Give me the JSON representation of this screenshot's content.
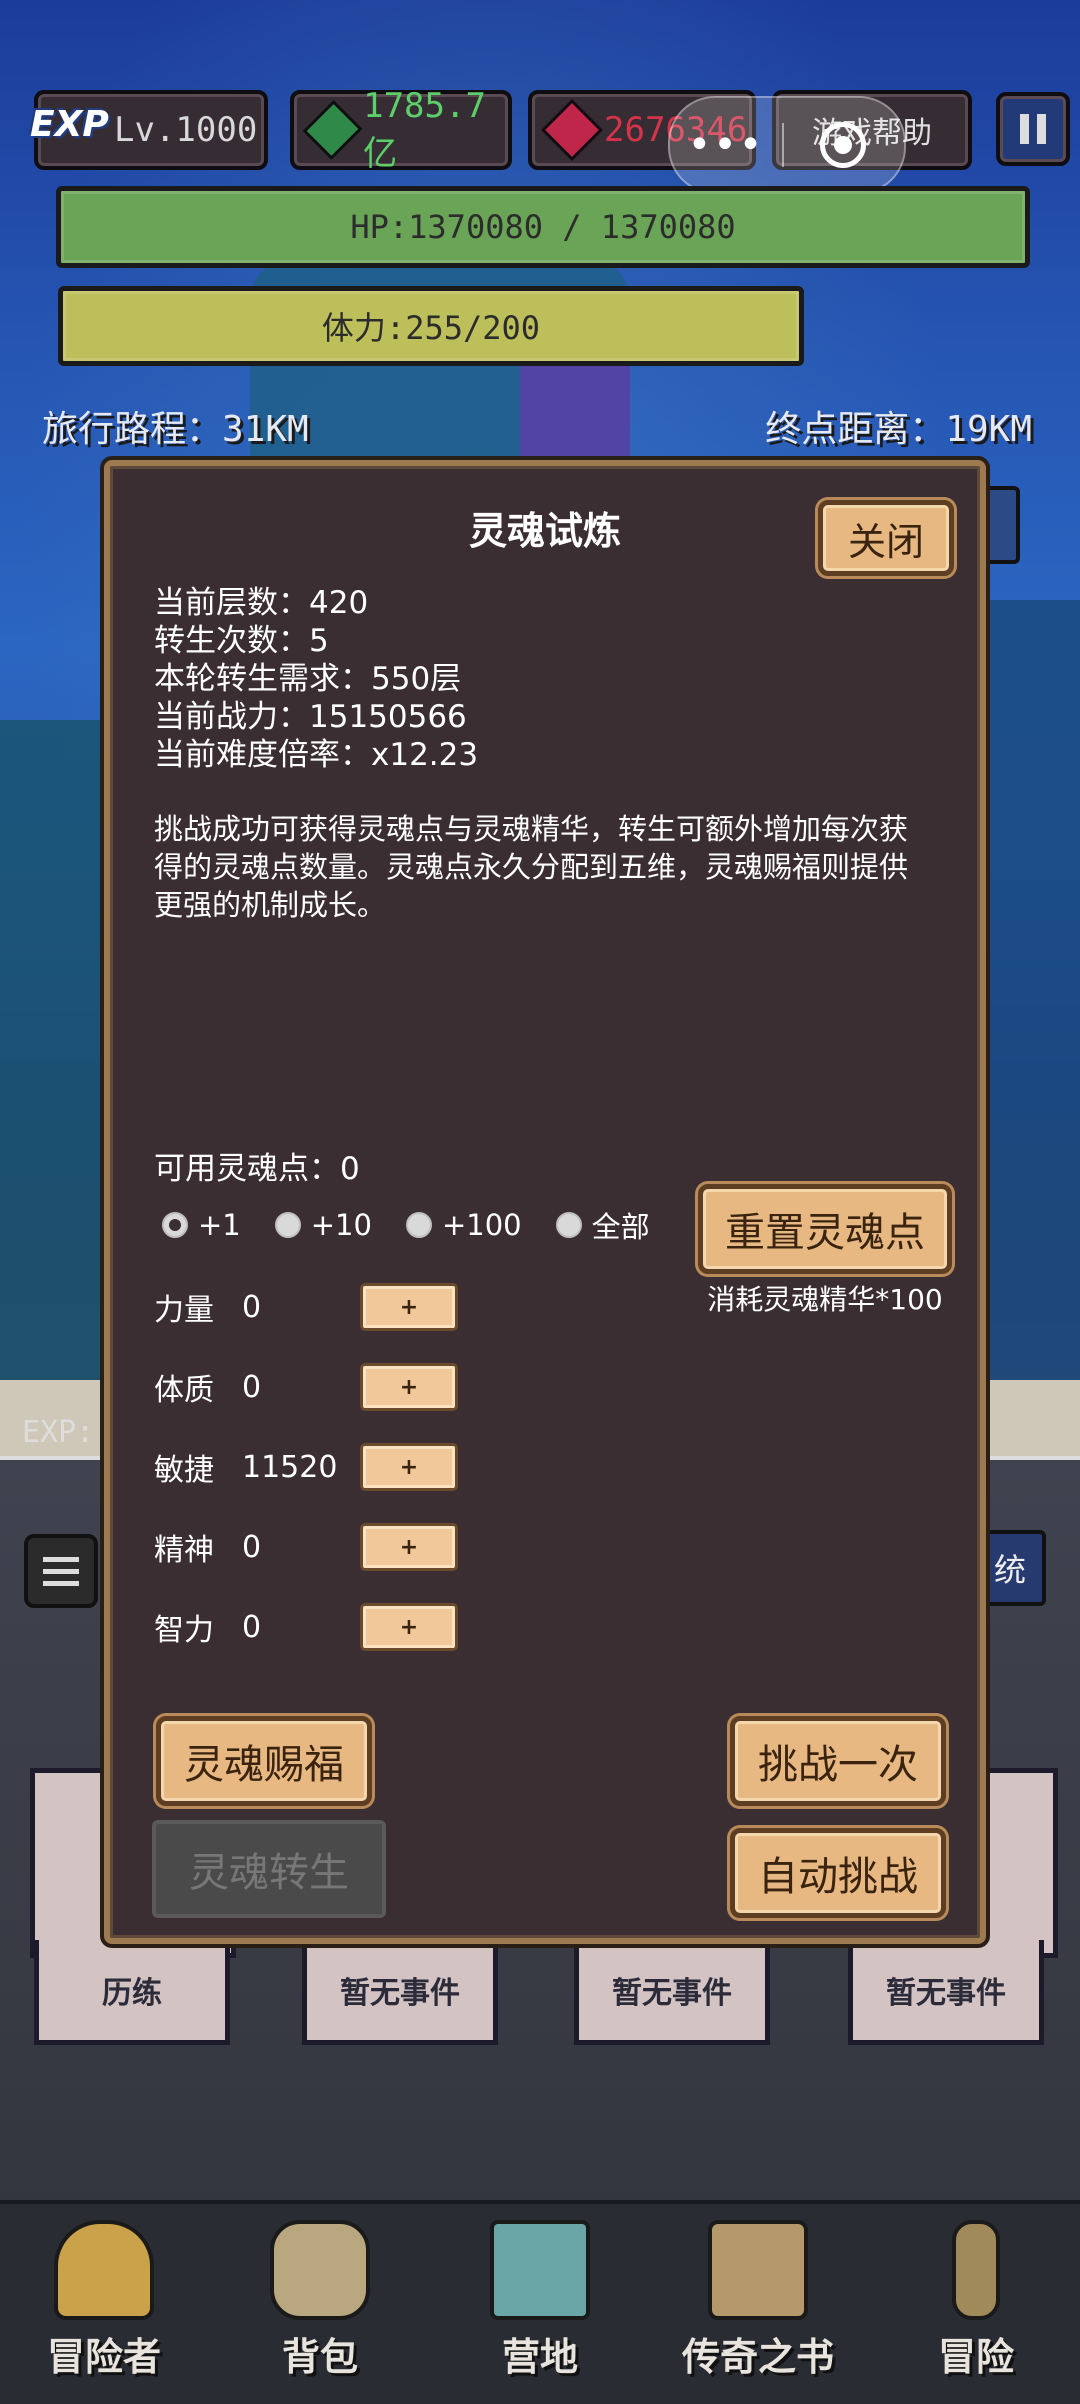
{
  "hud": {
    "exp_badge": "EXP",
    "level": "Lv.1000",
    "green_currency": "1785.7亿",
    "red_currency": "2676346",
    "help_button": "游戏帮助",
    "pause_icon": "pause-icon"
  },
  "wechat_capsule": {
    "more": "•••",
    "close_icon": "close-circle-icon"
  },
  "bars": {
    "hp": "HP:1370080 / 1370080",
    "stamina": "体力:255/200",
    "hp_color": "#6aa456",
    "stamina_color": "#bcbf5a"
  },
  "distance": {
    "traveled": "旅行路程：31KM",
    "remaining": "终点距离：19KM"
  },
  "background_labels": {
    "exp_partial": "EXP:",
    "system_partial": "统"
  },
  "modal": {
    "title": "灵魂试炼",
    "close_button": "关闭",
    "info": {
      "floor": "当前层数：420",
      "rebirths": "转生次数：5",
      "rebirth_req": "本轮转生需求：550层",
      "power": "当前战力：15150566",
      "difficulty": "当前难度倍率：x12.23"
    },
    "description": "挑战成功可获得灵魂点与灵魂精华，转生可额外增加每次获得的灵魂点数量。灵魂点永久分配到五维，灵魂赐福则提供更强的机制成长。",
    "available_points": "可用灵魂点：0",
    "increments": [
      {
        "label": "+1",
        "selected": true
      },
      {
        "label": "+10",
        "selected": false
      },
      {
        "label": "+100",
        "selected": false
      },
      {
        "label": "全部",
        "selected": false
      }
    ],
    "reset_button": "重置灵魂点",
    "reset_cost": "消耗灵魂精华*100",
    "stats": [
      {
        "name": "力量",
        "value": "0",
        "plus": "+"
      },
      {
        "name": "体质",
        "value": "0",
        "plus": "+"
      },
      {
        "name": "敏捷",
        "value": "11520",
        "plus": "+"
      },
      {
        "name": "精神",
        "value": "0",
        "plus": "+"
      },
      {
        "name": "智力",
        "value": "0",
        "plus": "+"
      }
    ],
    "blessing_button": "灵魂赐福",
    "challenge_once_button": "挑战一次",
    "rebirth_button": "灵魂转生",
    "auto_challenge_button": "自动挑战"
  },
  "events": [
    "历练",
    "暂无事件",
    "暂无事件",
    "暂无事件"
  ],
  "nav": [
    {
      "label": "冒险者",
      "icon": "helmet-icon",
      "color": "#c9a24a"
    },
    {
      "label": "背包",
      "icon": "backpack-icon",
      "color": "#b9a77f"
    },
    {
      "label": "营地",
      "icon": "camp-banner-icon",
      "color": "#6aa6a8"
    },
    {
      "label": "传奇之书",
      "icon": "book-icon",
      "color": "#b49a6a"
    },
    {
      "label": "冒险",
      "icon": "sword-icon",
      "color": "#a08a5a"
    }
  ]
}
